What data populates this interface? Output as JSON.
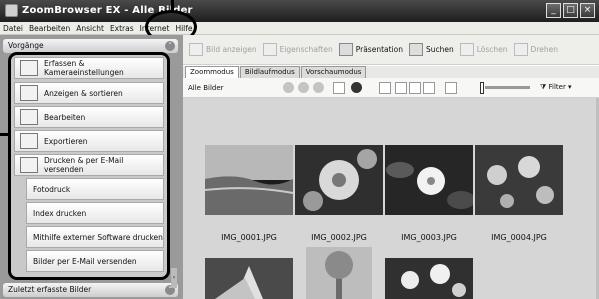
{
  "window": {
    "title": "ZoomBrowser EX - Alle Bilder",
    "buttons": [
      "_",
      "□",
      "×"
    ]
  },
  "menubar": [
    "Datei",
    "Bearbeiten",
    "Ansicht",
    "Extras",
    "Internet",
    "Hilfe"
  ],
  "left_panel": {
    "header": "Vorgänge",
    "tasks": [
      {
        "label": "Erfassen & Kameraeinstellungen",
        "icon": "camera-icon"
      },
      {
        "label": "Anzeigen & sortieren",
        "icon": "books-icon"
      },
      {
        "label": "Bearbeiten",
        "icon": "pencil-icon"
      },
      {
        "label": "Exportieren",
        "icon": "export-icon"
      },
      {
        "label": "Drucken & per E-Mail versenden",
        "icon": "printer-icon"
      }
    ],
    "subtasks": [
      "Fotodruck",
      "Index drucken",
      "Mithilfe externer Software drucken",
      "Bilder per E-Mail versenden"
    ],
    "footer": "Zuletzt erfasste Bilder"
  },
  "toolbar": [
    {
      "label": "Bild anzeigen",
      "enabled": false
    },
    {
      "label": "Eigenschaften",
      "enabled": false
    },
    {
      "label": "Präsentation",
      "enabled": true
    },
    {
      "label": "Suchen",
      "enabled": true
    },
    {
      "label": "Löschen",
      "enabled": false
    },
    {
      "label": "Drehen",
      "enabled": false
    }
  ],
  "tabs": [
    "Zoommodus",
    "Bildlaufmodus",
    "Vorschaumodus"
  ],
  "view": {
    "title": "Alle Bilder",
    "filter": "Filter"
  },
  "thumbnails": [
    "IMG_0001.JPG",
    "IMG_0002.JPG",
    "IMG_0003.JPG",
    "IMG_0004.JPG"
  ],
  "colors": {
    "titlebar": "#2a2a2a",
    "panel": "#9a9a9a",
    "content": "#d6d6d6",
    "callout": "#000000"
  }
}
